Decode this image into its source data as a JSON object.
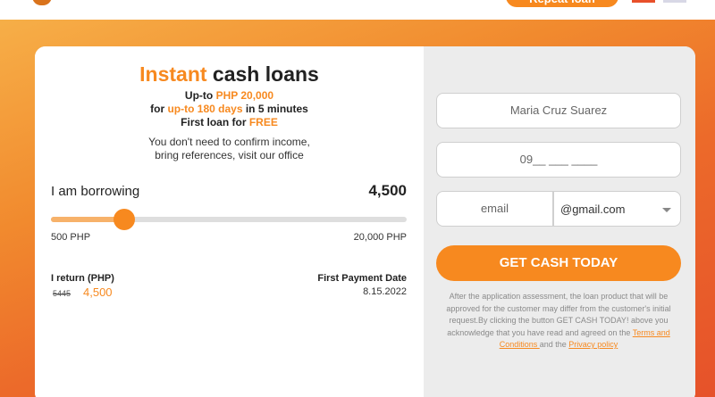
{
  "header": {
    "repeat_loan_label": "Repeat loan"
  },
  "promo": {
    "title_highlight": "Instant",
    "title_rest": " cash loans",
    "line1_prefix": "Up-to ",
    "line1_value": "PHP 20,000",
    "line2_prefix": "for ",
    "line2_value": "up-to 180 days",
    "line2_suffix": " in 5 minutes",
    "line3_prefix": "First loan for ",
    "line3_value": "FREE",
    "sub1": "You don't need to confirm income,",
    "sub2": "bring references, visit our office"
  },
  "calculator": {
    "borrowing_label": "I am borrowing",
    "amount": "4,500",
    "slider_fraction": 0.206,
    "min_label": "500 PHP",
    "max_label": "20,000 PHP",
    "return_label": "I return (PHP)",
    "return_old": "5445",
    "return_new": "4,500",
    "first_payment_label": "First Payment Date",
    "first_payment_date": "8.15.2022"
  },
  "form": {
    "name_value": "Maria Cruz Suarez",
    "phone_placeholder": "09__ ___ ____",
    "email_placeholder": "email",
    "email_domain": "@gmail.com",
    "submit_label": "GET CASH TODAY",
    "disclaimer_text": "After the application assessment, the loan product that will be approved for the customer may differ from the customer's initial request.By clicking the button GET CASH TODAY! above you acknowledge that you have read and agreed on the ",
    "terms_link": "Terms and Conditions ",
    "and_text": "and the ",
    "privacy_link": "Privacy policy"
  },
  "colors": {
    "accent": "#f7891f",
    "accent_light": "#f7b26a"
  }
}
